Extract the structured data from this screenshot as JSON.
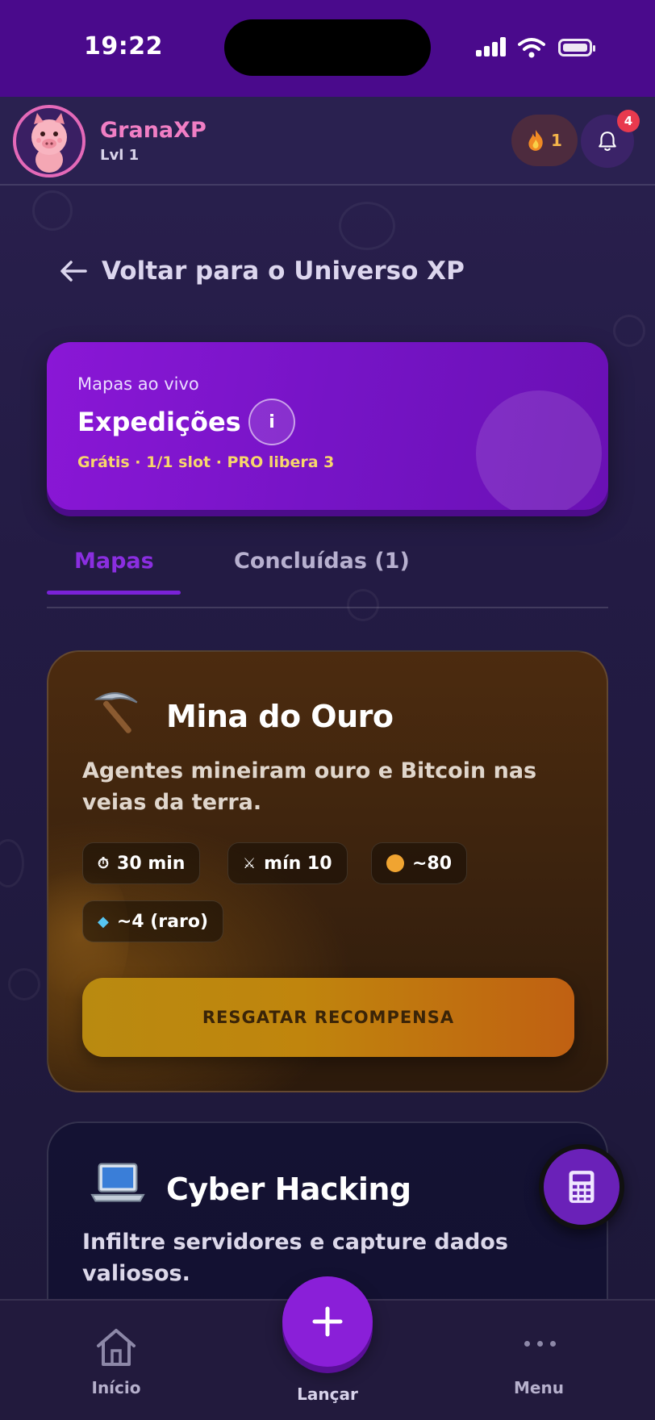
{
  "status_bar": {
    "time": "19:22"
  },
  "header": {
    "brand": "GranaXP",
    "level": "Lvl 1",
    "streak_count": "1",
    "notifications_count": "4"
  },
  "back_link": {
    "label": "Voltar para o Universo XP"
  },
  "banner": {
    "kicker": "Mapas ao vivo",
    "title": "Expedições",
    "info_label": "i",
    "subtitle": "Grátis · 1/1 slot · PRO libera 3"
  },
  "tabs": [
    {
      "label": "Mapas",
      "active": true
    },
    {
      "label": "Concluídas (1)",
      "active": false
    }
  ],
  "missions": [
    {
      "icon": "pickaxe-icon",
      "title": "Mina do Ouro",
      "description": "Agentes mineiram ouro e Bitcoin nas veias da terra.",
      "chips": [
        {
          "icon": "timer-icon",
          "label": "30 min"
        },
        {
          "icon": "swords-icon",
          "label": "mín 10"
        },
        {
          "icon": "coin-icon",
          "label": "~80"
        },
        {
          "icon": "gem-icon",
          "label": "~4 (raro)"
        }
      ],
      "action_label": "RESGATAR RECOMPENSA"
    },
    {
      "icon": "laptop-icon",
      "title": "Cyber Hacking",
      "description": "Infiltre servidores e capture dados valiosos."
    }
  ],
  "bottom_nav": {
    "home": "Início",
    "launch": "Lançar",
    "menu": "Menu"
  },
  "colors": {
    "status_bar": "#4a0a8c",
    "accent_purple": "#8a1fd8",
    "brand_pink": "#f07ec4",
    "gold_button": "#c0850d"
  }
}
